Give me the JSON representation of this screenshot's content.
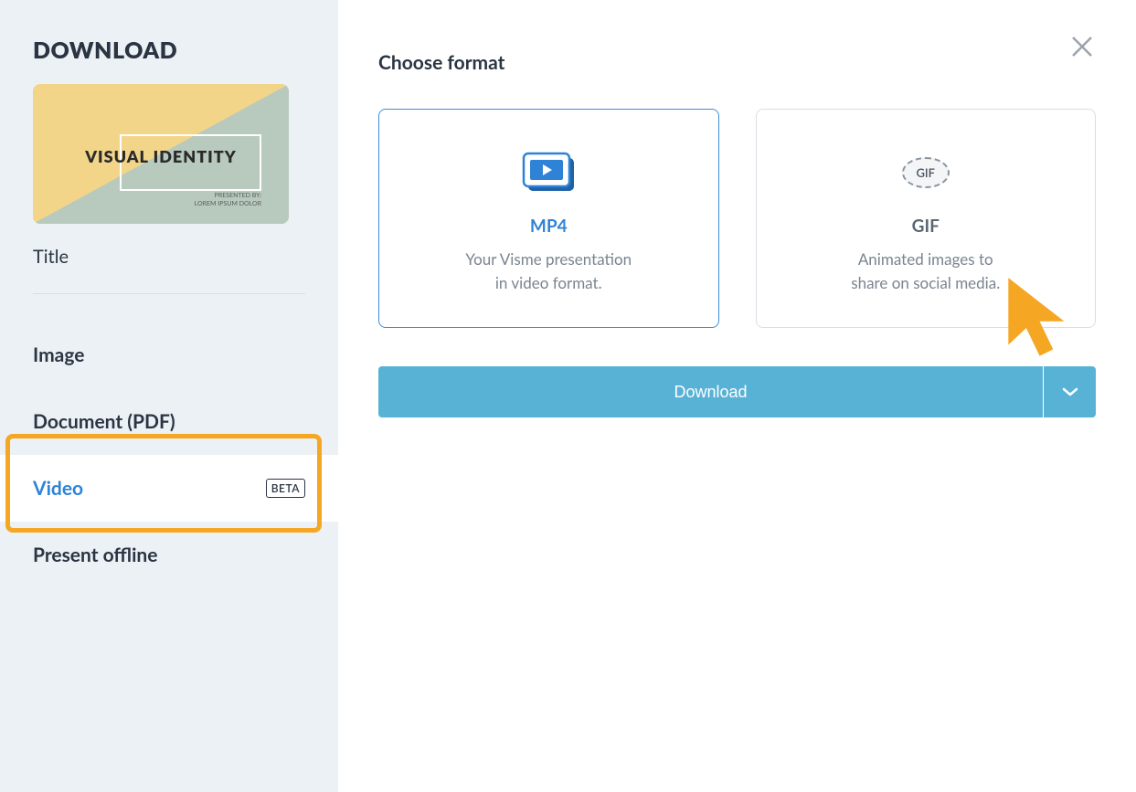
{
  "sidebar": {
    "title": "DOWNLOAD",
    "preview": {
      "title": "VISUAL IDENTITY",
      "subLine1": "PRESENTED BY:",
      "subLine2": "LOREM IPSUM DOLOR"
    },
    "titleLabel": "Title",
    "nav": {
      "image": "Image",
      "document": "Document (PDF)",
      "video": "Video",
      "videoBadge": "BETA",
      "present": "Present offline"
    }
  },
  "main": {
    "heading": "Choose format",
    "cards": {
      "mp4": {
        "title": "MP4",
        "descLine1": "Your Visme presentation",
        "descLine2": "in video format."
      },
      "gif": {
        "title": "GIF",
        "badge": "GIF",
        "descLine1": "Animated images to",
        "descLine2": "share on social media."
      }
    },
    "downloadLabel": "Download"
  }
}
